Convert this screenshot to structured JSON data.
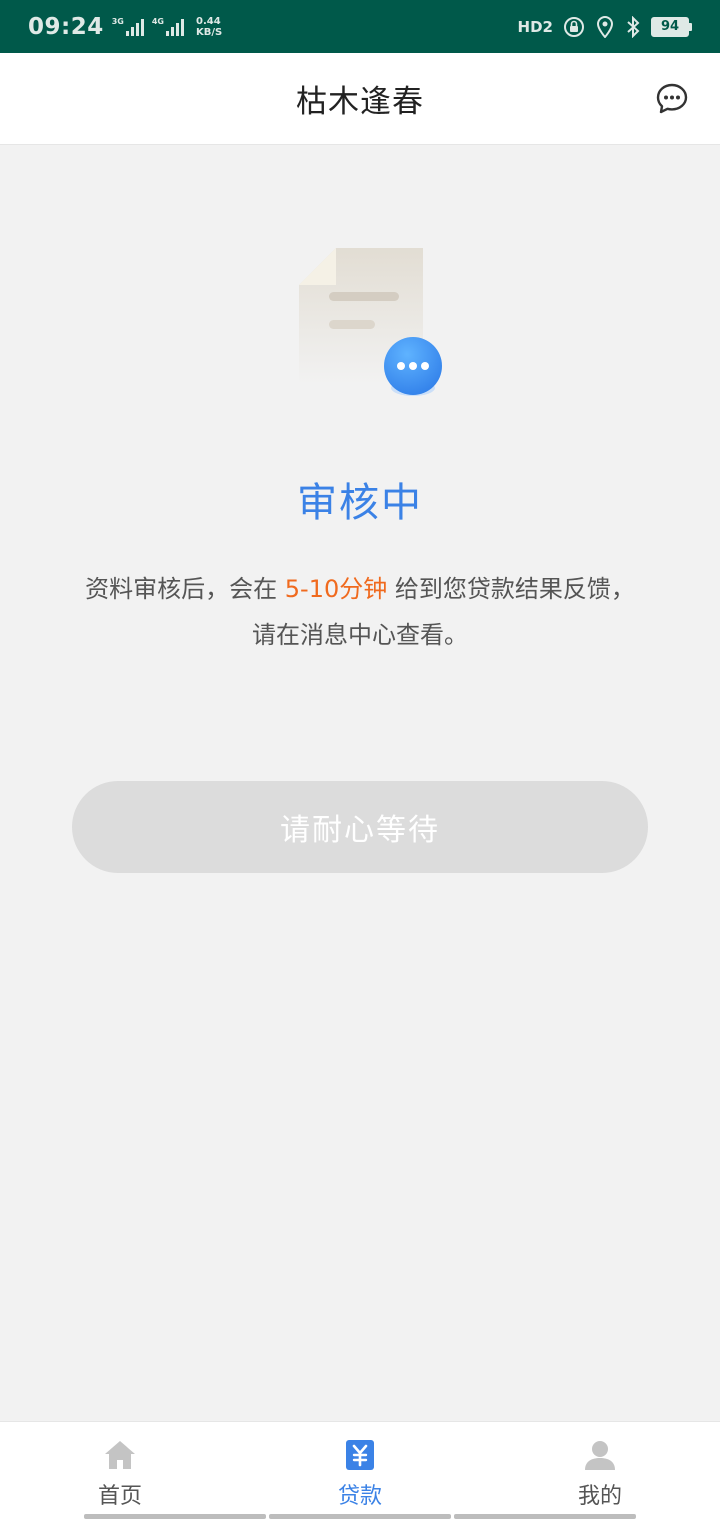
{
  "status_bar": {
    "time": "09:24",
    "net1": "3G",
    "net2": "4G",
    "speed_value": "0.44",
    "speed_unit": "KB/S",
    "hd_label": "HD2",
    "battery": "94"
  },
  "header": {
    "title": "枯木逢春",
    "message_icon": "chat-bubble-icon"
  },
  "status": {
    "title": "审核中",
    "desc_before": "资料审核后，会在 ",
    "desc_highlight": "5-10分钟",
    "desc_after": " 给到您贷款结果反馈，",
    "desc_line2": "请在消息中心查看。"
  },
  "action": {
    "wait_label": "请耐心等待"
  },
  "tabbar": {
    "items": [
      {
        "label": "首页",
        "icon": "home-icon"
      },
      {
        "label": "贷款",
        "icon": "yuan-icon"
      },
      {
        "label": "我的",
        "icon": "user-icon"
      }
    ]
  },
  "colors": {
    "status_bar_bg": "#00594a",
    "accent_blue": "#3b82e6",
    "highlight_orange": "#f06a1e",
    "disabled_button": "#dcdcdc"
  }
}
